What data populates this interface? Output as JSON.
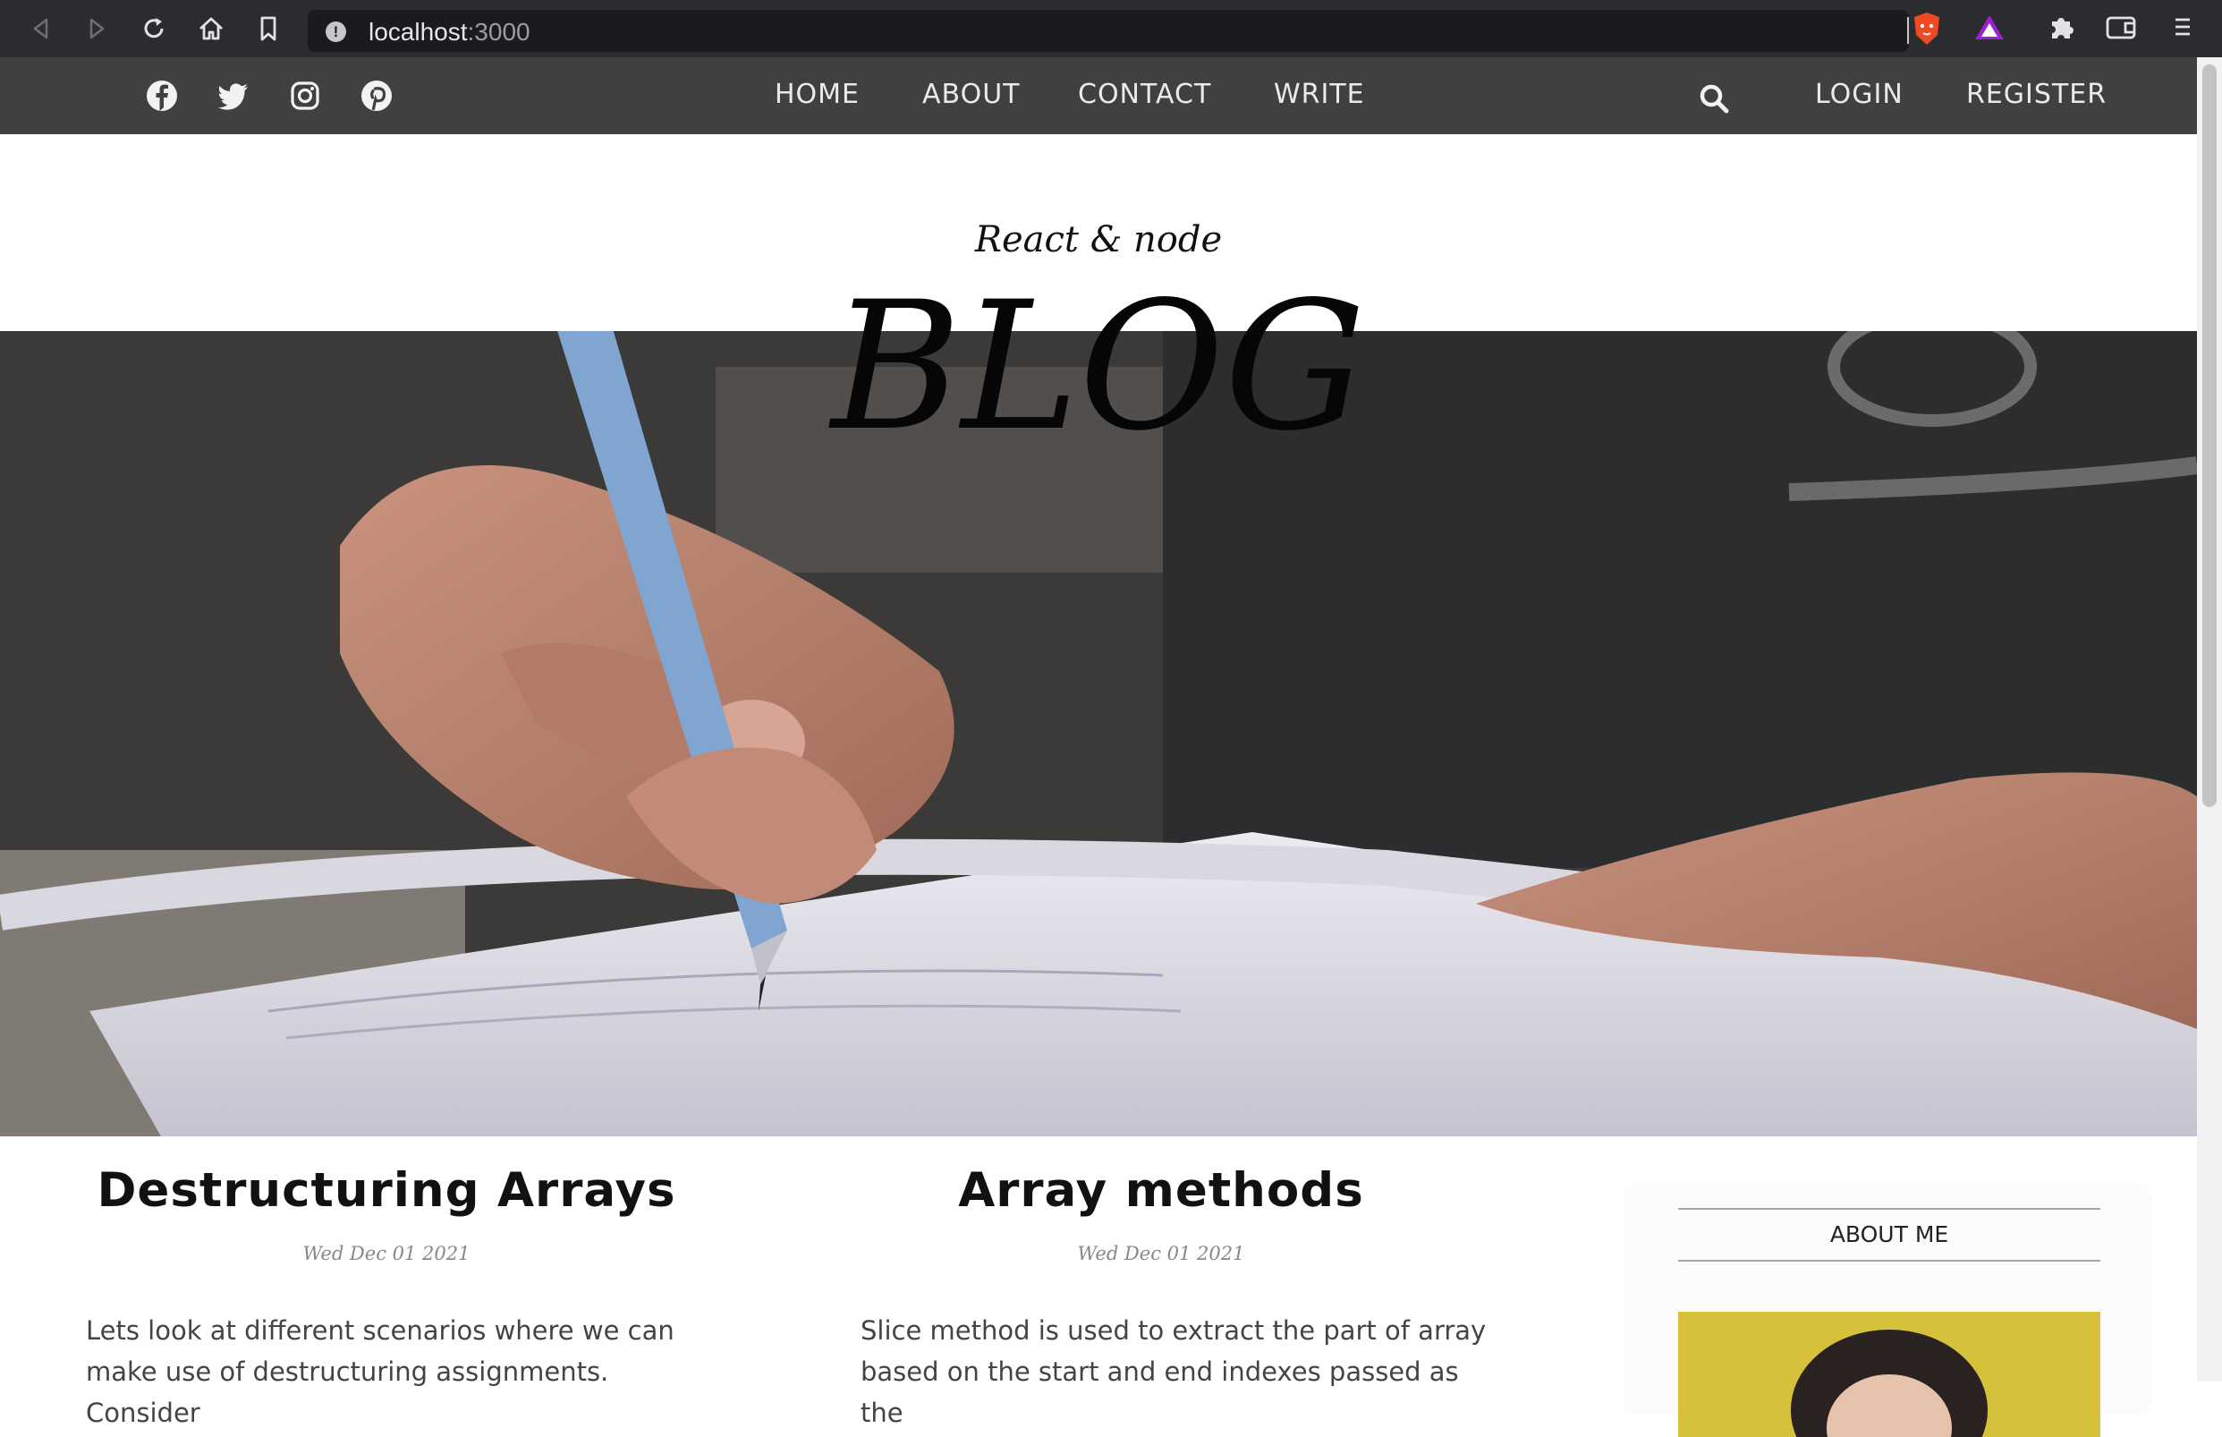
{
  "browser": {
    "url_host": "localhost",
    "url_port": ":3000",
    "icons": [
      "back-icon",
      "forward-icon",
      "reload-icon",
      "home-icon",
      "bookmark-icon",
      "site-info-icon",
      "brave-shield-icon",
      "brave-rewards-icon",
      "extensions-icon",
      "wallet-icon",
      "menu-icon"
    ]
  },
  "topbar": {
    "social_icons": [
      "facebook-icon",
      "twitter-icon",
      "instagram-icon",
      "pinterest-icon"
    ],
    "menu": [
      "HOME",
      "ABOUT",
      "CONTACT",
      "WRITE"
    ],
    "login": "LOGIN",
    "register": "REGISTER"
  },
  "header": {
    "subtitle": "React & node",
    "title": "BLOG"
  },
  "posts": [
    {
      "title": "Destructuring Arrays",
      "date": "Wed Dec 01 2021",
      "desc": "Lets look at different scenarios where we can make use of destructuring assignments. Consider"
    },
    {
      "title": "Array methods",
      "date": "Wed Dec 01 2021",
      "desc": "Slice method is used to extract the part of array based on the start and end indexes passed as the"
    }
  ],
  "sidebar": {
    "title": "ABOUT ME"
  },
  "colors": {
    "chrome_bg": "#2b2c30",
    "topbar_bg": "#404040",
    "sidebar_bg": "#fdfbfb"
  }
}
